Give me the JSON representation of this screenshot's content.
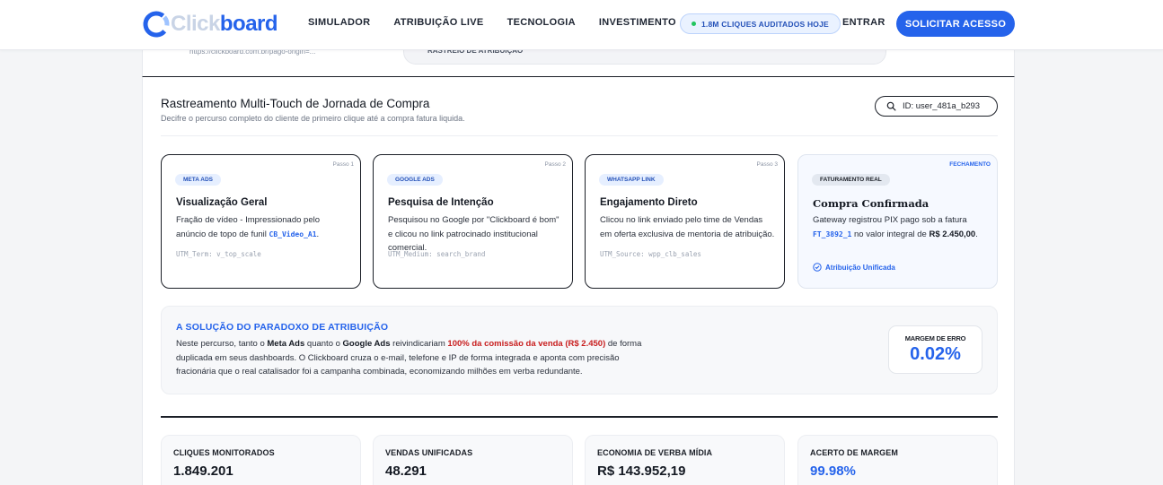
{
  "nav": {
    "logo_light": "Click",
    "logo_dark": "board",
    "links": [
      "SIMULADOR",
      "ATRIBUIÇÃO LIVE",
      "TECNOLOGIA",
      "INVESTIMENTO"
    ],
    "live_badge": "1.8M CLIQUES AUDITADOS HOJE",
    "login": "ENTRAR",
    "cta": "SOLICITAR ACESSO"
  },
  "ghost": {
    "url": "https://clickboard.com.br/pago-origin=...",
    "bar_label": "RASTREIO DE ATRIBUIÇÃO"
  },
  "journey": {
    "title": "Rastreamento Multi-Touch de Jornada de Compra",
    "subtitle": "Decifre o percurso completo do cliente de primeiro clique até a compra fatura liquida.",
    "user_id": "ID: user_481a_b293",
    "steps": [
      {
        "step": "Passo 1",
        "badge": "META ADS",
        "title": "Visualização Geral",
        "desc": "Fração de vídeo - Impressionado pelo anúncio de topo de funil ",
        "code": "CB_Video_A1",
        "desc_end": ".",
        "utm": "UTM_Term: v_top_scale"
      },
      {
        "step": "Passo 2",
        "badge": "GOOGLE ADS",
        "title": "Pesquisa de Intenção",
        "desc": "Pesquisou no Google por \"Clickboard é bom\" e clicou no link patrocinado institucional comercial.",
        "utm": "UTM_Medium: search_brand"
      },
      {
        "step": "Passo 3",
        "badge": "WHATSAPP LINK",
        "title": "Engajamento Direto",
        "desc": "Clicou no link enviado pelo time de Vendas em oferta exclusiva de mentoria de atribuição.",
        "utm": "UTM_Source: wpp_clb_sales"
      },
      {
        "step": "FECHAMENTO",
        "badge": "FATURAMENTO REAL",
        "title": "Compra Confirmada",
        "desc": "Gateway registrou PIX pago sob a fatura ",
        "code": "FT_3892_1",
        "desc_mid": " no valor integral de ",
        "amount": "R$ 2.450,00",
        "desc_end": ".",
        "unified": "Atribuição Unificada"
      }
    ]
  },
  "paradox": {
    "title": "A SOLUÇÃO DO PARADOXO DE ATRIBUIÇÃO",
    "p1": "Neste percurso, tanto o ",
    "meta": "Meta Ads",
    "p2": " quanto o ",
    "google": "Google Ads",
    "p3": " reivindicariam ",
    "highlight": "100% da comissão da venda (R$ 2.450)",
    "p4": " de forma duplicada em seus dashboards. O Clickboard cruza o e-mail, telefone e IP de forma integrada e aponta com precisão fracionária que o real catalisador foi a campanha combinada, economizando milhões em verba redundante.",
    "margin_label": "MARGEM DE ERRO",
    "margin_value": "0.02%"
  },
  "stats": [
    {
      "label": "CLIQUES MONITORADOS",
      "value": "1.849.201"
    },
    {
      "label": "VENDAS UNIFICADAS",
      "value": "48.291"
    },
    {
      "label": "ECONOMIA DE VERBA MÍDIA",
      "value": "R$ 143.952,19"
    },
    {
      "label": "ACERTO DE MARGEM",
      "value": "99.98%"
    }
  ],
  "colors": {
    "accent": "#2563eb",
    "alert": "#c81e1e",
    "live_dot": "#22c55e"
  }
}
